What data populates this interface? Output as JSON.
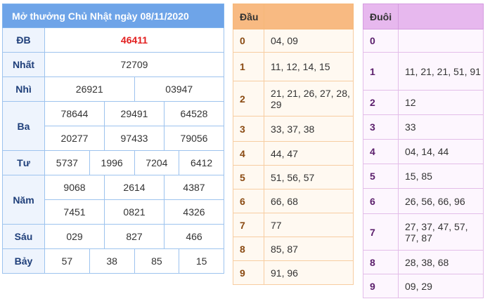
{
  "title": "Mở thưởng Chủ Nhật ngày 08/11/2020",
  "prizes": {
    "db": {
      "label": "ĐB",
      "values": [
        "46411"
      ]
    },
    "nhat": {
      "label": "Nhất",
      "values": [
        "72709"
      ]
    },
    "nhi": {
      "label": "Nhì",
      "values": [
        "26921",
        "03947"
      ]
    },
    "ba": {
      "label": "Ba",
      "values": [
        "78644",
        "29491",
        "64528",
        "20277",
        "97433",
        "79056"
      ]
    },
    "tu": {
      "label": "Tư",
      "values": [
        "5737",
        "1996",
        "7204",
        "6412"
      ]
    },
    "nam": {
      "label": "Năm",
      "values": [
        "9068",
        "2614",
        "4387",
        "7451",
        "0821",
        "4326"
      ]
    },
    "sau": {
      "label": "Sáu",
      "values": [
        "029",
        "827",
        "466"
      ]
    },
    "bay": {
      "label": "Bảy",
      "values": [
        "57",
        "38",
        "85",
        "15"
      ]
    }
  },
  "dau": {
    "header": "Đầu",
    "rows": [
      {
        "key": "0",
        "value": "04, 09"
      },
      {
        "key": "1",
        "value": "11, 12, 14, 15"
      },
      {
        "key": "2",
        "value": "21, 21, 26, 27, 28, 29"
      },
      {
        "key": "3",
        "value": "33, 37, 38"
      },
      {
        "key": "4",
        "value": "44, 47"
      },
      {
        "key": "5",
        "value": "51, 56, 57"
      },
      {
        "key": "6",
        "value": "66, 68"
      },
      {
        "key": "7",
        "value": "77"
      },
      {
        "key": "8",
        "value": "85, 87"
      },
      {
        "key": "9",
        "value": "91, 96"
      }
    ]
  },
  "duoi": {
    "header": "Đuôi",
    "rows": [
      {
        "key": "0",
        "value": ""
      },
      {
        "key": "1",
        "value": "11, 21, 21, 51, 91"
      },
      {
        "key": "2",
        "value": "12"
      },
      {
        "key": "3",
        "value": "33"
      },
      {
        "key": "4",
        "value": "04, 14, 44"
      },
      {
        "key": "5",
        "value": "15, 85"
      },
      {
        "key": "6",
        "value": "26, 56, 66, 96"
      },
      {
        "key": "7",
        "value": "27, 37, 47, 57, 77, 87"
      },
      {
        "key": "8",
        "value": "28, 38, 68"
      },
      {
        "key": "9",
        "value": "09, 29"
      }
    ]
  },
  "colors": {
    "results_header": "#6ea4e8",
    "special_prize_text": "#e21f1f",
    "dau_header": "#f8ba82",
    "duoi_header": "#e7b8ee"
  }
}
